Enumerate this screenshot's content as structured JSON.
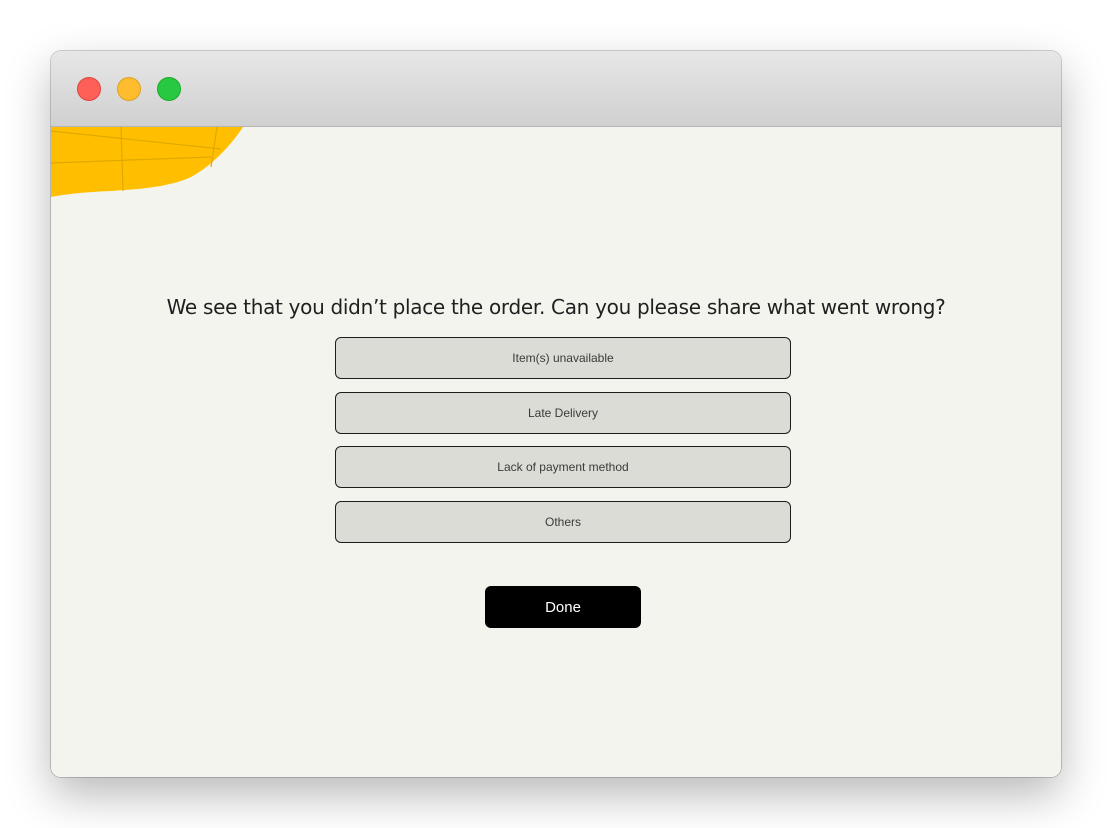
{
  "window": {
    "controls": {
      "close_icon": "close-dot-icon",
      "minimize_icon": "minimize-dot-icon",
      "zoom_icon": "zoom-dot-icon"
    }
  },
  "survey": {
    "question": "We see that you didn’t place the order. Can you please share what went wrong?",
    "options": [
      {
        "label": "Item(s) unavailable"
      },
      {
        "label": "Late Delivery"
      },
      {
        "label": "Lack of payment method"
      },
      {
        "label": "Others"
      }
    ],
    "done_label": "Done"
  },
  "colors": {
    "background": "#f4f4ef",
    "accent_yellow": "#ffbf00",
    "option_fill": "#dcdcd7",
    "button_fill": "#000000"
  }
}
